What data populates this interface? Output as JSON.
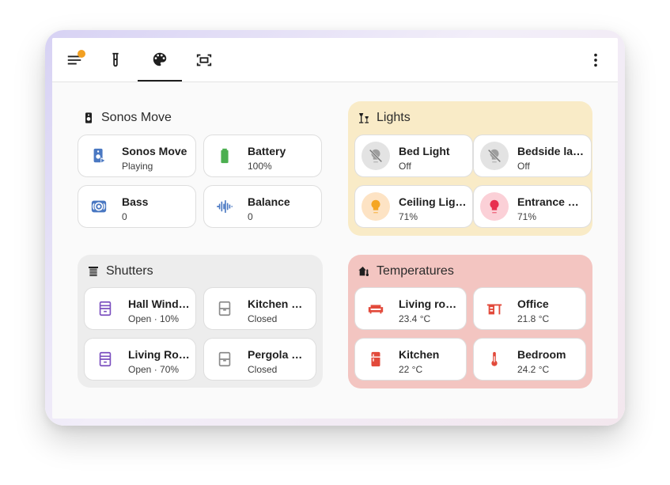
{
  "colors": {
    "accent_orange": "#f2a023",
    "lights_bg": "#f9ebc7",
    "temps_bg": "#f3c5c1",
    "shutters_bg": "#ededed",
    "shutter_icon": "#7b4fbf",
    "temp_icon": "#e24a3b",
    "blue_icon": "#4a78c2"
  },
  "toolbar": {
    "tabs": [
      {
        "icon": "menu-icon",
        "badge": true
      },
      {
        "icon": "test-tube-icon"
      },
      {
        "icon": "palette-icon",
        "active": true
      },
      {
        "icon": "fit-screen-icon"
      }
    ],
    "overflow_icon": "more-vertical-icon"
  },
  "sonos": {
    "title": "Sonos Move",
    "icon": "speaker-icon",
    "cards": [
      {
        "name": "Sonos Move",
        "state": "Playing",
        "icon": "speaker-play-icon"
      },
      {
        "name": "Battery",
        "state": "100%",
        "icon": "battery-icon"
      },
      {
        "name": "Bass",
        "state": "0",
        "icon": "surround-sound-icon"
      },
      {
        "name": "Balance",
        "state": "0",
        "icon": "waveform-icon"
      }
    ]
  },
  "lights": {
    "title": "Lights",
    "icon": "lamps-icon",
    "cards": [
      {
        "name": "Bed Light",
        "state": "Off",
        "icon": "lightbulb-off-icon"
      },
      {
        "name": "Bedside la…",
        "state": "Off",
        "icon": "lightbulb-off-icon"
      },
      {
        "name": "Ceiling Lig…",
        "state": "71%",
        "icon": "lightbulb-on-icon"
      },
      {
        "name": "Entrance …",
        "state": "71%",
        "icon": "lightbulb-on-icon"
      }
    ]
  },
  "shutters": {
    "title": "Shutters",
    "icon": "blinds-icon",
    "cards": [
      {
        "name": "Hall Wind…",
        "state": "Open · 10%",
        "icon": "window-shutter-open-icon"
      },
      {
        "name": "Kitchen W…",
        "state": "Closed",
        "icon": "window-shutter-closed-icon"
      },
      {
        "name": "Living Roo…",
        "state": "Open · 70%",
        "icon": "window-shutter-open-icon"
      },
      {
        "name": "Pergola R…",
        "state": "Closed",
        "icon": "window-shutter-closed-icon"
      }
    ]
  },
  "temperatures": {
    "title": "Temperatures",
    "icon": "home-thermometer-icon",
    "cards": [
      {
        "name": "Living room",
        "state": "23.4 °C",
        "icon": "sofa-icon"
      },
      {
        "name": "Office",
        "state": "21.8 °C",
        "icon": "desk-icon"
      },
      {
        "name": "Kitchen",
        "state": "22 °C",
        "icon": "fridge-icon"
      },
      {
        "name": "Bedroom",
        "state": "24.2 °C",
        "icon": "thermometer-icon"
      }
    ]
  }
}
